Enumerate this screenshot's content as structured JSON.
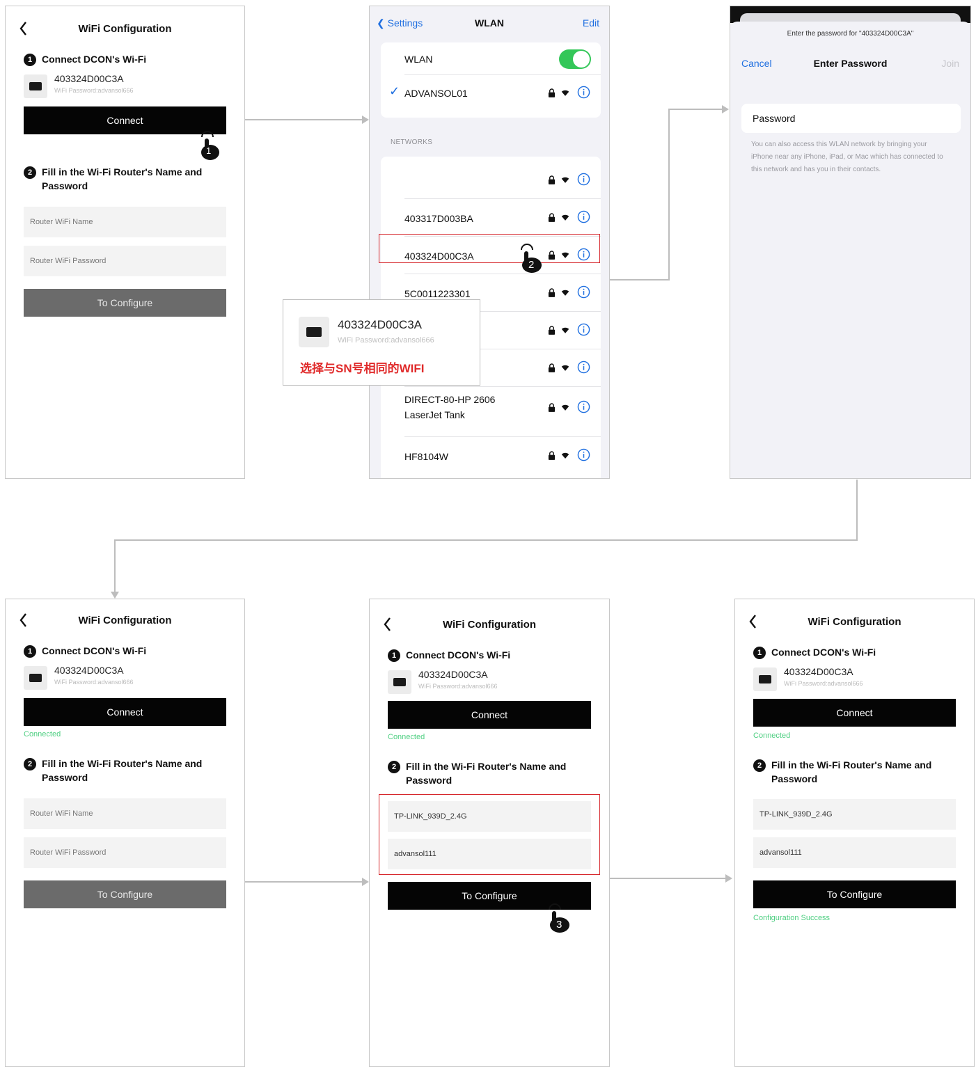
{
  "app": {
    "title": "WiFi Configuration",
    "step1": {
      "number": "1",
      "label": "Connect DCON's Wi-Fi"
    },
    "device": {
      "name": "403324D00C3A",
      "password": "WiFi Password:advansol666"
    },
    "connect_label": "Connect",
    "connected_label": "Connected",
    "step2": {
      "number": "2",
      "label": "Fill in the Wi-Fi Router's Name and Password"
    },
    "router_name_placeholder": "Router WiFi Name",
    "router_password_placeholder": "Router WiFi Password",
    "router_name_value": "TP-LINK_939D_2.4G",
    "router_password_value": "advansol111",
    "configure_label": "To Configure",
    "success_label": "Configuration Success"
  },
  "wlan": {
    "back_label": "Settings",
    "title": "WLAN",
    "edit_label": "Edit",
    "wlan_label": "WLAN",
    "connected_network": "ADVANSOL01",
    "networks_header": "NETWORKS",
    "networks": [
      "",
      "403317D003BA",
      "403324D00C3A",
      "5C0011223301",
      "",
      "",
      "DIRECT-80-HP 2606 LaserJet Tank",
      "HF8104W"
    ]
  },
  "callout": {
    "name": "403324D00C3A",
    "password": "WiFi Password:advansol666",
    "note": "选择与SN号相同的WIFI"
  },
  "password_screen": {
    "prompt": "Enter the password for \"403324D00C3A\"",
    "cancel_label": "Cancel",
    "title": "Enter Password",
    "join_label": "Join",
    "field_label": "Password",
    "hint": "You can also access this WLAN network by bringing your iPhone near any iPhone, iPad, or Mac which has connected to this network and has you in their contacts."
  },
  "taps": {
    "one": "1",
    "two": "2",
    "three": "3"
  },
  "colors": {
    "accent": "#1f6fe0",
    "success": "#4fcf82",
    "highlight": "#d6262b",
    "toggle": "#34c759"
  }
}
